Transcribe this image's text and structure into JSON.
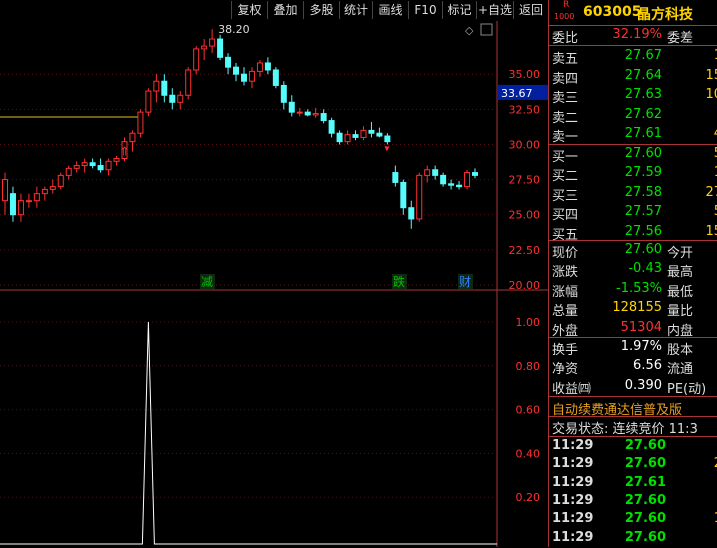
{
  "toolbar": {
    "buttons": [
      "复权",
      "叠加",
      "多股",
      "统计",
      "画线",
      "F10",
      "标记",
      "+自选",
      "返回"
    ]
  },
  "chart": {
    "price_axis": [
      "35.00",
      "32.50",
      "30.00",
      "27.50",
      "25.00",
      "22.50",
      "20.00"
    ],
    "current_price_tag": "33.67",
    "peak_label": "38.20",
    "event_markers": [
      "减",
      "跌",
      "财"
    ],
    "indicator_axis": [
      "1.00",
      "0.80",
      "0.60",
      "0.40",
      "0.20"
    ],
    "corner_icon": "diamond-icon"
  },
  "chart_data": {
    "type": "candlestick",
    "ylim": [
      20,
      38.5
    ],
    "candles": [
      [
        26,
        28,
        25,
        27.5
      ],
      [
        26.5,
        27,
        24.5,
        25
      ],
      [
        25,
        26.5,
        24.5,
        26
      ],
      [
        26,
        26.5,
        25.5,
        26
      ],
      [
        26,
        27,
        25.5,
        26.5
      ],
      [
        26.5,
        27,
        26,
        26.8
      ],
      [
        26.8,
        27.5,
        26.5,
        27
      ],
      [
        27,
        28,
        26.8,
        27.8
      ],
      [
        27.8,
        28.5,
        27.5,
        28.3
      ],
      [
        28.3,
        28.8,
        28,
        28.5
      ],
      [
        28.5,
        29,
        28,
        28.7
      ],
      [
        28.7,
        29,
        28.3,
        28.5
      ],
      [
        28.5,
        29,
        28,
        28.2
      ],
      [
        28.2,
        29,
        27.8,
        28.8
      ],
      [
        28.8,
        29.2,
        28.5,
        29
      ],
      [
        29,
        30.5,
        28.8,
        30.2
      ],
      [
        30.2,
        31,
        29.5,
        30.8
      ],
      [
        30.8,
        32.5,
        30.5,
        32.3
      ],
      [
        32.3,
        34,
        32,
        33.8
      ],
      [
        33.8,
        35,
        33,
        34.5
      ],
      [
        34.5,
        35,
        33,
        33.5
      ],
      [
        33.5,
        34,
        32.5,
        33
      ],
      [
        33,
        33.8,
        32.5,
        33.5
      ],
      [
        33.5,
        35.5,
        33.2,
        35.3
      ],
      [
        35.3,
        37,
        35,
        36.8
      ],
      [
        36.8,
        37.5,
        36,
        37
      ],
      [
        37,
        38.2,
        36.5,
        37.5
      ],
      [
        37.5,
        37.8,
        36,
        36.2
      ],
      [
        36.2,
        36.5,
        35,
        35.5
      ],
      [
        35.5,
        35.8,
        34.5,
        35
      ],
      [
        35,
        35.5,
        34.2,
        34.5
      ],
      [
        34.5,
        35.5,
        34,
        35.2
      ],
      [
        35.2,
        36,
        34.8,
        35.8
      ],
      [
        35.8,
        36.2,
        35,
        35.3
      ],
      [
        35.3,
        35.5,
        34,
        34.2
      ],
      [
        34.2,
        34.5,
        32.5,
        33
      ],
      [
        33,
        33.5,
        32,
        32.3
      ],
      [
        32.3,
        32.6,
        32,
        32.3
      ],
      [
        32.3,
        32.5,
        32,
        32.1
      ],
      [
        32.1,
        32.6,
        31.9,
        32.2
      ],
      [
        32.2,
        32.5,
        31.5,
        31.7
      ],
      [
        31.7,
        31.9,
        30.5,
        30.8
      ],
      [
        30.8,
        31,
        30,
        30.2
      ],
      [
        30.2,
        31,
        30,
        30.7
      ],
      [
        30.7,
        31,
        30.3,
        30.5
      ],
      [
        30.5,
        31.3,
        30.3,
        31
      ],
      [
        31,
        31.6,
        30.5,
        30.8
      ],
      [
        30.8,
        31.2,
        30.5,
        30.6
      ],
      [
        30.6,
        30.8,
        30,
        30.2
      ],
      [
        28,
        28.5,
        27,
        27.3
      ],
      [
        27.3,
        27.5,
        25,
        25.5
      ],
      [
        25.5,
        26,
        24,
        24.7
      ],
      [
        24.7,
        28,
        24.5,
        27.8
      ],
      [
        27.8,
        28.5,
        27.3,
        28.2
      ],
      [
        28.2,
        28.5,
        27.5,
        27.8
      ],
      [
        27.8,
        28,
        27,
        27.2
      ],
      [
        27.2,
        27.5,
        26.8,
        27.1
      ],
      [
        27.1,
        27.4,
        26.8,
        27
      ],
      [
        27,
        28.2,
        26.8,
        28
      ],
      [
        28,
        28.3,
        27.6,
        27.8
      ]
    ],
    "indicator": {
      "spike_index": 18,
      "spike_value": 1.0,
      "ylim": [
        0,
        1.05
      ]
    }
  },
  "quote": {
    "code": "603005",
    "name": "晶方科技",
    "badge_top": "R",
    "badge_bottom": "1000",
    "weibi_label": "委比",
    "weibi_value": "32.19%",
    "weicha_label": "委差",
    "sell": [
      {
        "label": "卖五",
        "price": "27.67",
        "vol": "1"
      },
      {
        "label": "卖四",
        "price": "27.64",
        "vol": "15"
      },
      {
        "label": "卖三",
        "price": "27.63",
        "vol": "10"
      },
      {
        "label": "卖二",
        "price": "27.62",
        "vol": ""
      },
      {
        "label": "卖一",
        "price": "27.61",
        "vol": "4"
      }
    ],
    "buy": [
      {
        "label": "买一",
        "price": "27.60",
        "vol": "5"
      },
      {
        "label": "买二",
        "price": "27.59",
        "vol": "1"
      },
      {
        "label": "买三",
        "price": "27.58",
        "vol": "27"
      },
      {
        "label": "买四",
        "price": "27.57",
        "vol": "5"
      },
      {
        "label": "买五",
        "price": "27.56",
        "vol": "15"
      }
    ],
    "stats": [
      {
        "label": "现价",
        "value": "27.60",
        "label2": "今开",
        "cls": "green"
      },
      {
        "label": "涨跌",
        "value": "-0.43",
        "label2": "最高",
        "cls": "green"
      },
      {
        "label": "涨幅",
        "value": "-1.53%",
        "label2": "最低",
        "cls": "green"
      },
      {
        "label": "总量",
        "value": "128155",
        "label2": "量比",
        "cls": "yellow"
      },
      {
        "label": "外盘",
        "value": "51304",
        "label2": "内盘",
        "cls": "red"
      }
    ],
    "stats2": [
      {
        "label": "换手",
        "value": "1.97%",
        "label2": "股本"
      },
      {
        "label": "净资",
        "value": "6.56",
        "label2": "流通"
      },
      {
        "label": "收益㈣",
        "value": "0.390",
        "label2": "PE(动)"
      }
    ],
    "banner": "自动续费通达信普及版",
    "trade_status": "交易状态: 连续竞价 11:3",
    "ticks": [
      {
        "time": "11:29",
        "price": "27.60",
        "vol": "",
        "cls": "green"
      },
      {
        "time": "11:29",
        "price": "27.60",
        "vol": "2",
        "cls": "green"
      },
      {
        "time": "11:29",
        "price": "27.61",
        "vol": "",
        "cls": "green"
      },
      {
        "time": "11:29",
        "price": "27.60",
        "vol": "",
        "cls": "green"
      },
      {
        "time": "11:29",
        "price": "27.60",
        "vol": "1",
        "cls": "green"
      },
      {
        "time": "11:29",
        "price": "27.60",
        "vol": "",
        "cls": "green"
      }
    ]
  }
}
